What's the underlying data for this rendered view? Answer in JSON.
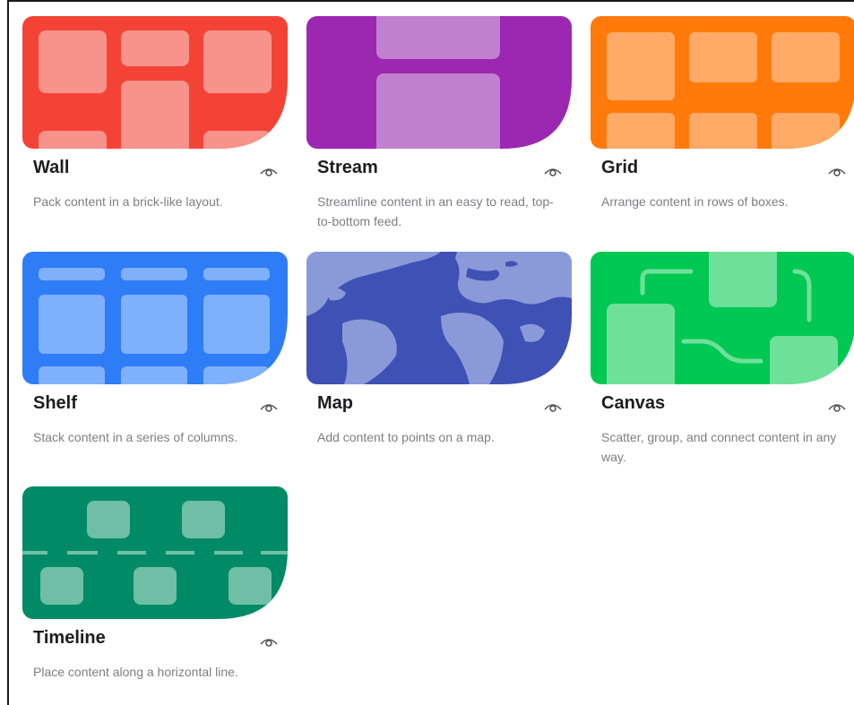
{
  "layouts": [
    {
      "id": "wall",
      "title": "Wall",
      "description": "Pack content in a brick-like layout.",
      "color": "#f44336",
      "icon": "eye-icon"
    },
    {
      "id": "stream",
      "title": "Stream",
      "description": "Streamline content in an easy to read, top-to-bottom feed.",
      "color": "#9c27b0",
      "icon": "eye-icon"
    },
    {
      "id": "grid",
      "title": "Grid",
      "description": "Arrange content in rows of boxes.",
      "color": "#ff7a0a",
      "icon": "eye-icon"
    },
    {
      "id": "shelf",
      "title": "Shelf",
      "description": "Stack content in a series of columns.",
      "color": "#2f7df6",
      "icon": "eye-icon"
    },
    {
      "id": "map",
      "title": "Map",
      "description": "Add content to points on a map.",
      "color": "#3f51b5",
      "icon": "eye-icon"
    },
    {
      "id": "canvas",
      "title": "Canvas",
      "description": "Scatter, group, and connect content in any way.",
      "color": "#00c853",
      "icon": "eye-icon"
    },
    {
      "id": "timeline",
      "title": "Timeline",
      "description": "Place content along a horizontal line.",
      "color": "#008a66",
      "icon": "eye-icon"
    }
  ]
}
